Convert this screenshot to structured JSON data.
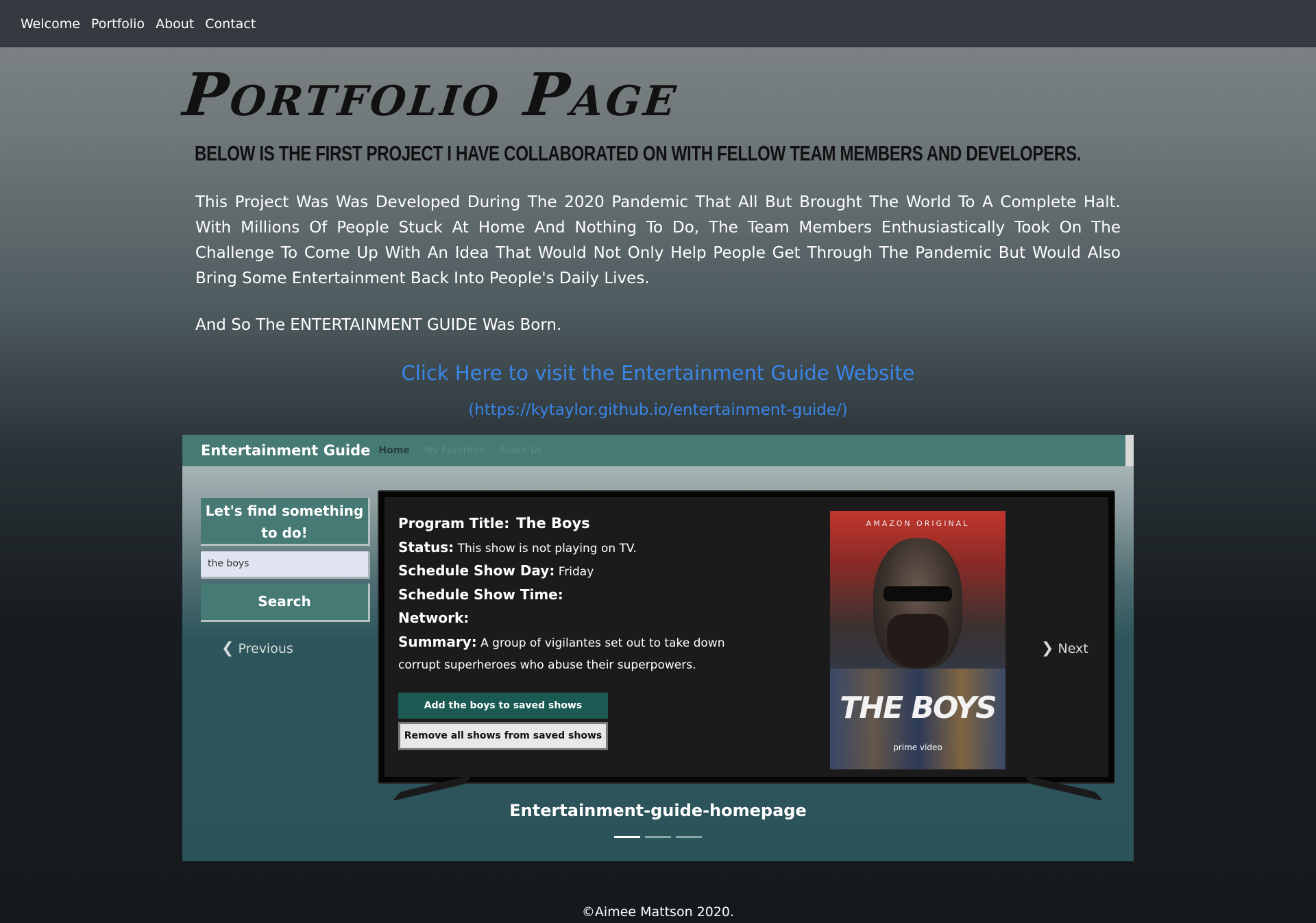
{
  "nav": {
    "items": [
      "Welcome",
      "Portfolio",
      "About",
      "Contact"
    ]
  },
  "page": {
    "title": "Portfolio Page",
    "subheading": "Below is the first project I have collaborated on with fellow team members and developers.",
    "intro": "This Project Was Was Developed During The 2020 Pandemic That All But Brought The World To A Complete Halt. With Millions Of People Stuck At Home And Nothing To Do, The Team Members Enthusiastically Took On The Challenge To Come Up With An Idea That Would Not Only Help People Get Through The Pandemic But Would Also Bring Some Entertainment Back Into People's Daily Lives.",
    "born": "And So The ENTERTAINMENT GUIDE Was Born.",
    "link_text": "Click Here to visit the Entertainment Guide Website",
    "link_url": "(https://kytaylor.github.io/entertainment-guide/)"
  },
  "screenshot": {
    "brand": "Entertainment Guide",
    "nav": [
      "Home",
      "My Favorites",
      "About Us"
    ],
    "find_heading": "Let's find something to do!",
    "search_value": "the boys",
    "search_button": "Search",
    "prev": "Previous",
    "next": "Next",
    "program_title_label": "Program Title:",
    "program_title": "The Boys",
    "status_label": "Status:",
    "status": "This show is not playing on TV.",
    "day_label": "Schedule Show Day:",
    "day": "Friday",
    "time_label": "Schedule Show Time:",
    "network_label": "Network:",
    "summary_label": "Summary:",
    "summary": "A group of vigilantes set out to take down corrupt superheroes who abuse their superpowers.",
    "add_button": "Add the boys to saved shows",
    "remove_button": "Remove all shows from saved shows",
    "poster_top": "AMAZON ORIGINAL",
    "poster_logo": "THE BOYS",
    "poster_bottom": "prime video",
    "caption": "Entertainment-guide-homepage"
  },
  "footer": "©Aimee Mattson 2020."
}
